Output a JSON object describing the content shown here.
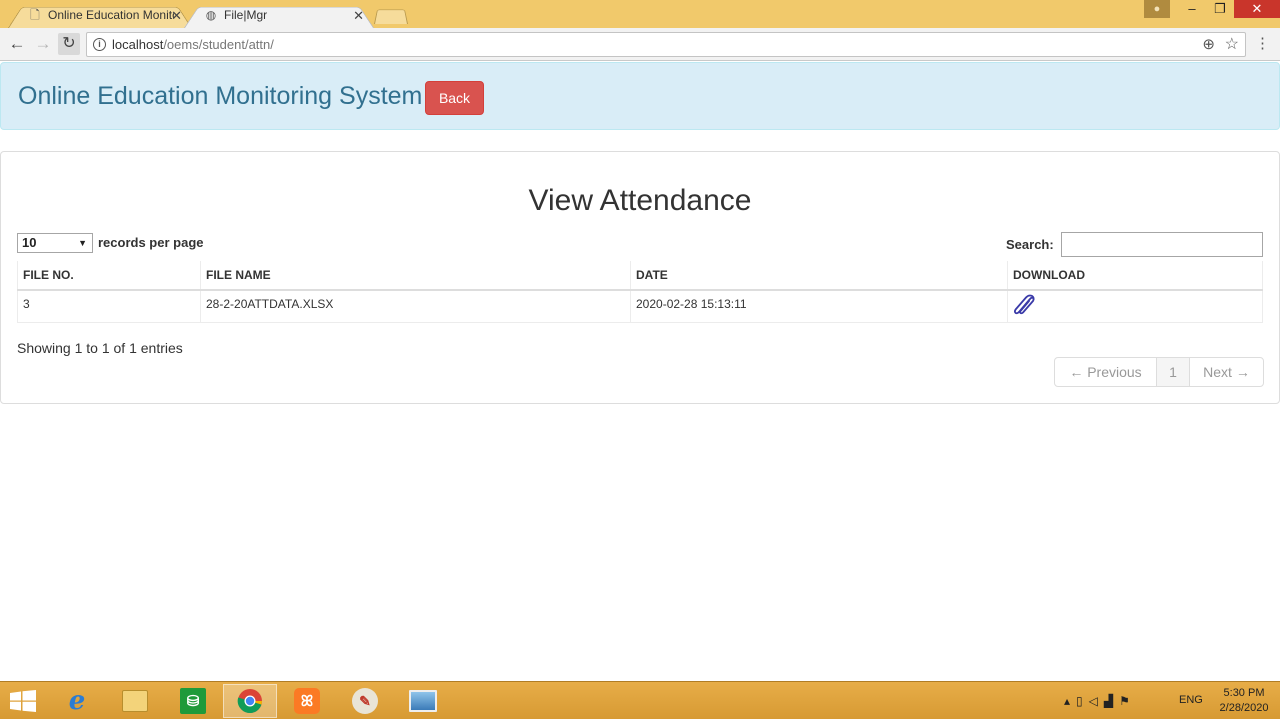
{
  "browser": {
    "tabs": [
      {
        "title": "Online Education Monitoring System",
        "icon": "page-icon",
        "active": false
      },
      {
        "title": "File|Mgr",
        "icon": "globe-icon",
        "active": true
      }
    ],
    "close_glyph": "✕",
    "url_host": "localhost",
    "url_path": "/oems/student/attn/"
  },
  "navbar": {
    "brand": "Online Education Monitoring System",
    "back_label": "Back"
  },
  "page": {
    "title": "View Attendance",
    "length_value": "10",
    "length_label": "records per page",
    "search_label": "Search:",
    "search_value": "",
    "info": "Showing 1 to 1 of 1 entries",
    "pager": {
      "prev": "← Previous",
      "current": "1",
      "next": "Next →"
    }
  },
  "table": {
    "headers": [
      "FILE NO.",
      "FILE NAME",
      "DATE",
      "DOWNLOAD"
    ],
    "rows": [
      {
        "file_no": "3",
        "file_name": "28-2-20ATTDATA.XLSX",
        "date": "2020-02-28 15:13:11",
        "download_icon": "paperclip-icon"
      }
    ]
  },
  "taskbar": {
    "apps": [
      "internet-explorer",
      "file-explorer",
      "store",
      "chrome",
      "xampp",
      "paint",
      "photos"
    ],
    "lang": "ENG",
    "time": "5:30 PM",
    "date": "2/28/2020"
  },
  "colors": {
    "danger": "#d9534f",
    "info_bg": "#d9edf7",
    "brand_text": "#31708f",
    "chrome_frame": "#f1c96b",
    "taskbar": "#dca23b"
  }
}
